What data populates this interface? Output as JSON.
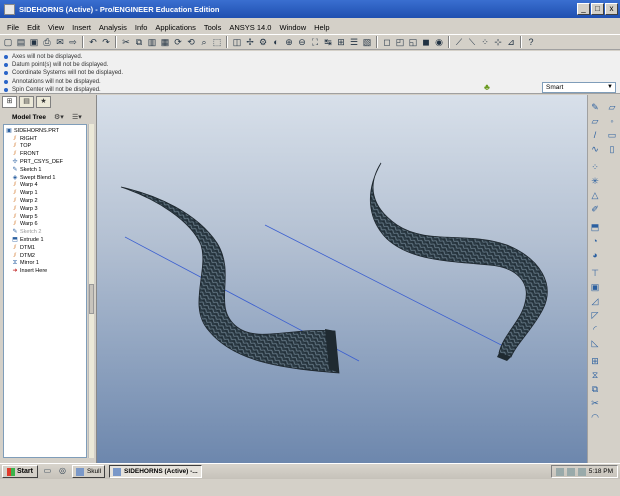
{
  "window": {
    "title": "SIDEHORNS (Active) - Pro/ENGINEER Education Edition",
    "controls": [
      "_",
      "□",
      "x"
    ]
  },
  "menu": [
    "File",
    "Edit",
    "View",
    "Insert",
    "Analysis",
    "Info",
    "Applications",
    "Tools",
    "ANSYS 14.0",
    "Window",
    "Help"
  ],
  "messages": [
    "Axes will not be displayed.",
    "Datum point(s) will not be displayed.",
    "Coordinate Systems will not be displayed.",
    "Annotations will not be displayed.",
    "Spin Center will not be displayed."
  ],
  "filter": {
    "value": "Smart"
  },
  "model_tree": {
    "header": "Model Tree",
    "items": [
      {
        "label": "SIDEHORNS.PRT",
        "icon": "part-icon",
        "dim": false
      },
      {
        "label": "RIGHT",
        "icon": "datum-plane-icon",
        "dim": false
      },
      {
        "label": "TOP",
        "icon": "datum-plane-icon",
        "dim": false
      },
      {
        "label": "FRONT",
        "icon": "datum-plane-icon",
        "dim": false
      },
      {
        "label": "PRT_CSYS_DEF",
        "icon": "csys-icon",
        "dim": false
      },
      {
        "label": "Sketch 1",
        "icon": "sketch-icon",
        "dim": false
      },
      {
        "label": "Swept Blend 1",
        "icon": "swept-blend-icon",
        "dim": false
      },
      {
        "label": "Warp 4",
        "icon": "warp-icon",
        "dim": false
      },
      {
        "label": "Warp 1",
        "icon": "warp-icon",
        "dim": false
      },
      {
        "label": "Warp 2",
        "icon": "warp-icon",
        "dim": false
      },
      {
        "label": "Warp 3",
        "icon": "warp-icon",
        "dim": false
      },
      {
        "label": "Warp 5",
        "icon": "warp-icon",
        "dim": false
      },
      {
        "label": "Warp 6",
        "icon": "warp-icon",
        "dim": false
      },
      {
        "label": "Sketch 2",
        "icon": "sketch-icon",
        "dim": true
      },
      {
        "label": "Extrude 1",
        "icon": "extrude-icon",
        "dim": false
      },
      {
        "label": "DTM1",
        "icon": "datum-plane-icon",
        "dim": false
      },
      {
        "label": "DTM2",
        "icon": "datum-plane-icon",
        "dim": false
      },
      {
        "label": "Mirror 1",
        "icon": "mirror-icon",
        "dim": false
      },
      {
        "label": "Insert Here",
        "icon": "insert-arrow-icon",
        "dim": false
      }
    ]
  },
  "taskbar": {
    "start": "Start",
    "tasks": [
      {
        "label": "Skull",
        "active": false
      },
      {
        "label": "SIDEHORNS (Active) -...",
        "active": true
      }
    ],
    "clock": "5:18 PM"
  },
  "colors": {
    "title_bar": "#2456c0",
    "viewport_top": "#d8e0ea",
    "viewport_bottom": "#6d87ad",
    "horn": "#2b3a44",
    "axis_line": "#3b5fd0"
  }
}
